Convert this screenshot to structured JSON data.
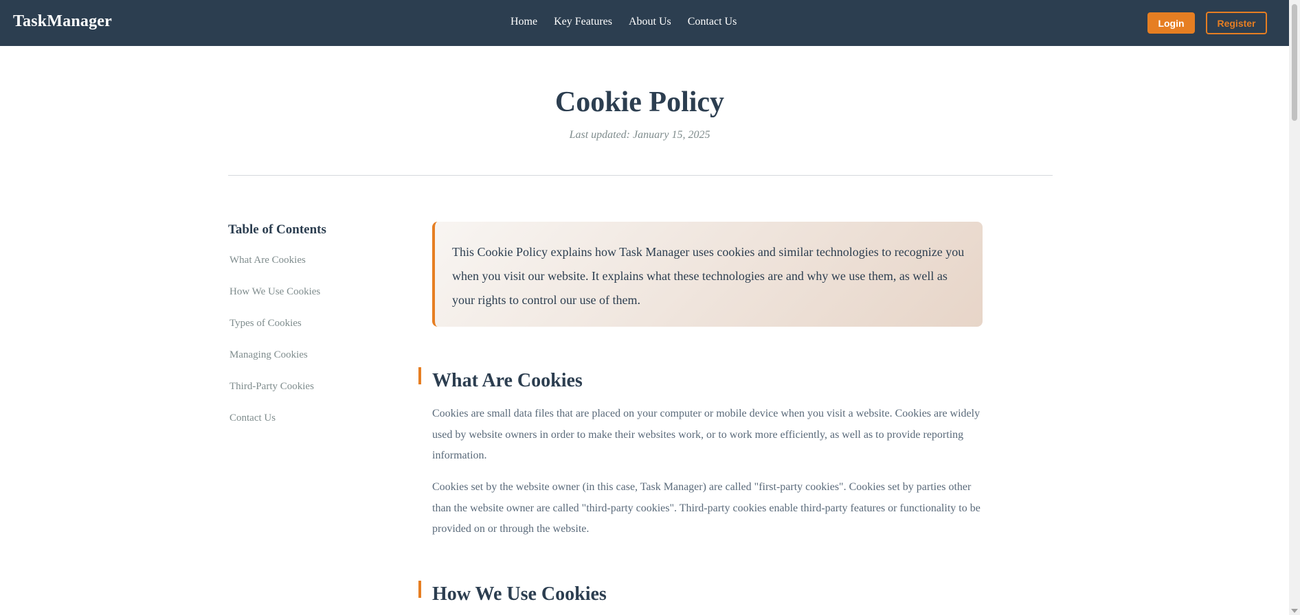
{
  "header": {
    "brand": "TaskManager",
    "nav": [
      "Home",
      "Key Features",
      "About Us",
      "Contact Us"
    ],
    "login_label": "Login",
    "register_label": "Register"
  },
  "page": {
    "title": "Cookie Policy",
    "last_updated": "Last updated: January 15, 2025"
  },
  "toc": {
    "title": "Table of Contents",
    "items": [
      "What Are Cookies",
      "How We Use Cookies",
      "Types of Cookies",
      "Managing Cookies",
      "Third-Party Cookies",
      "Contact Us"
    ]
  },
  "intro": "This Cookie Policy explains how Task Manager uses cookies and similar technologies to recognize you when you visit our website. It explains what these technologies are and why we use them, as well as your rights to control our use of them.",
  "sections": [
    {
      "heading": "What Are Cookies",
      "paragraphs": [
        "Cookies are small data files that are placed on your computer or mobile device when you visit a website. Cookies are widely used by website owners in order to make their websites work, or to work more efficiently, as well as to provide reporting information.",
        "Cookies set by the website owner (in this case, Task Manager) are called \"first-party cookies\". Cookies set by parties other than the website owner are called \"third-party cookies\". Third-party cookies enable third-party features or functionality to be provided on or through the website."
      ]
    },
    {
      "heading": "How We Use Cookies"
    }
  ],
  "colors": {
    "navbar": "#2c3e50",
    "accent": "#e67e22",
    "heading": "#2c3e50",
    "muted": "#7f8c8d"
  }
}
